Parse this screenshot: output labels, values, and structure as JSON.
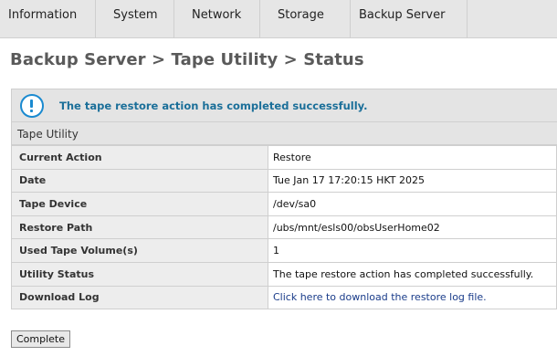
{
  "nav": {
    "tabs": [
      {
        "label": "Information"
      },
      {
        "label": "System"
      },
      {
        "label": "Network"
      },
      {
        "label": "Storage"
      },
      {
        "label": "Backup Server"
      }
    ]
  },
  "page": {
    "title": "Backup Server > Tape Utility > Status"
  },
  "message": {
    "icon": "info-icon",
    "text": "The tape restore action has completed successfully."
  },
  "section": {
    "title": "Tape Utility"
  },
  "rows": [
    {
      "label": "Current Action",
      "value": "Restore"
    },
    {
      "label": "Date",
      "value": "Tue Jan 17 17:20:15 HKT 2025"
    },
    {
      "label": "Tape Device",
      "value": "/dev/sa0"
    },
    {
      "label": "Restore Path",
      "value": "/ubs/mnt/esls00/obsUserHome02"
    },
    {
      "label": "Used Tape Volume(s)",
      "value": "1"
    },
    {
      "label": "Utility Status",
      "value": "The tape restore action has completed successfully."
    },
    {
      "label": "Download Log",
      "value": "Click here to download the restore log file."
    }
  ],
  "actions": {
    "complete_label": "Complete"
  }
}
